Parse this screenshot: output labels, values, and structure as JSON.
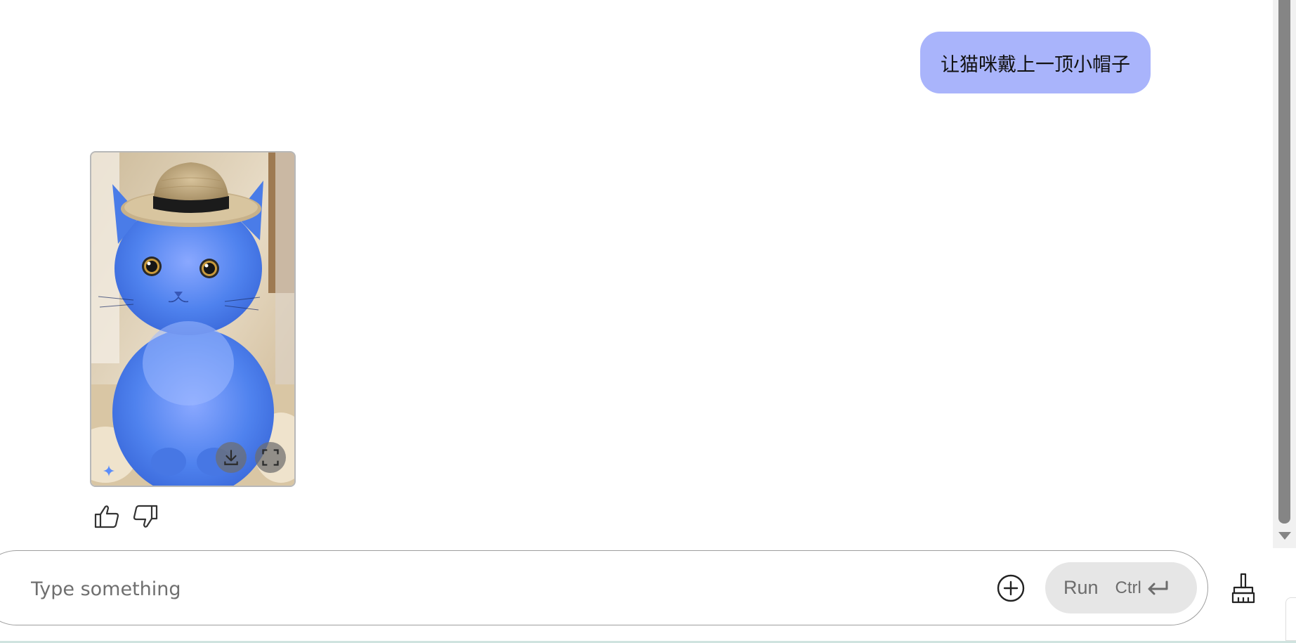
{
  "chat": {
    "user_message": "让猫咪戴上一顶小帽子"
  },
  "response": {
    "image_alt": "Blue cat wearing a small straw hat",
    "download_icon": "download-icon",
    "fullscreen_icon": "fullscreen-icon",
    "sparkle_icon": "sparkle-icon"
  },
  "feedback": {
    "like_icon": "thumbs-up-icon",
    "dislike_icon": "thumbs-down-icon"
  },
  "composer": {
    "placeholder": "Type something",
    "value": "",
    "run_label": "Run",
    "shortcut_label": "Ctrl",
    "add_icon": "plus-circle-icon",
    "clear_icon": "broom-icon"
  },
  "colors": {
    "bubble": "#a9b4fb",
    "run_button_bg": "#e6e6e6",
    "cat_blue": "#4a86e8"
  }
}
